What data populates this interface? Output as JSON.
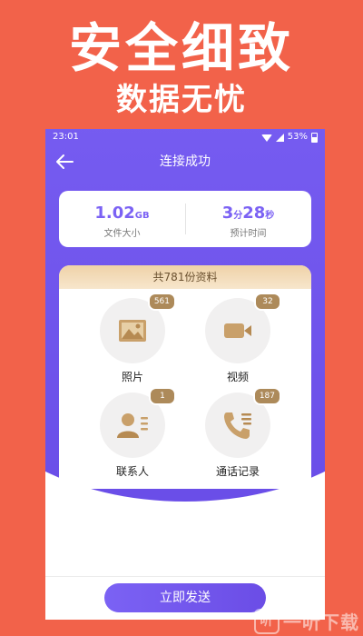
{
  "promo": {
    "title": "安全细致",
    "subtitle": "数据无忧"
  },
  "status_bar": {
    "time": "23:01",
    "battery": "53%"
  },
  "header": {
    "title": "连接成功"
  },
  "stats": {
    "size_value": "1.02",
    "size_unit": "GB",
    "size_label": "文件大小",
    "time_min": "3",
    "time_min_unit": "分",
    "time_sec": "28",
    "time_sec_unit": "秒",
    "time_label": "预计时间"
  },
  "data_card": {
    "header": "共781份资料",
    "categories": [
      {
        "label": "照片",
        "count": "561",
        "icon": "photo-icon"
      },
      {
        "label": "视频",
        "count": "32",
        "icon": "video-icon"
      },
      {
        "label": "联系人",
        "count": "1",
        "icon": "contacts-icon"
      },
      {
        "label": "通话记录",
        "count": "187",
        "icon": "call-log-icon"
      }
    ]
  },
  "footer": {
    "send_label": "立即发送"
  },
  "watermark": {
    "text": "一听下载"
  },
  "colors": {
    "primary": "#7b62f4",
    "accent_gold": "#ad8a5a",
    "background": "#f2624a"
  }
}
